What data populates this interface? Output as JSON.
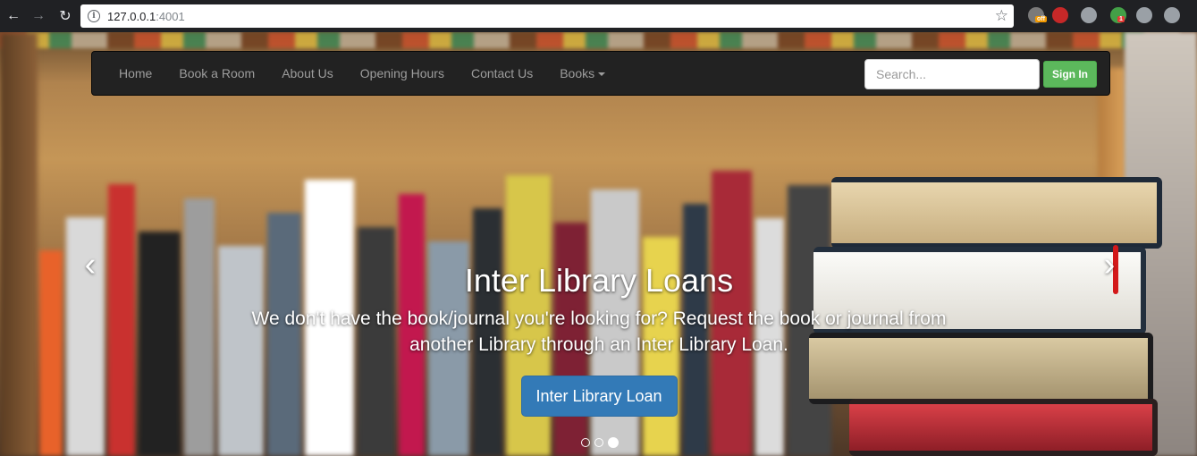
{
  "browser": {
    "url_host": "127.0.0.1",
    "url_port": ":4001",
    "extensions": [
      {
        "icon": "extension-off-icon",
        "badge": "off",
        "color": "#7a7a7a",
        "badge_color": "#f29900"
      },
      {
        "icon": "ublock-icon",
        "badge": "",
        "color": "#c62828",
        "badge_color": ""
      },
      {
        "icon": "comment-icon",
        "badge": "",
        "color": "#9aa0a6",
        "badge_color": ""
      },
      {
        "icon": "pushbullet-icon",
        "badge": "1",
        "color": "#43a047",
        "badge_color": "#e53935"
      },
      {
        "icon": "search-extension-icon",
        "badge": "",
        "color": "#9aa0a6",
        "badge_color": ""
      },
      {
        "icon": "drive-icon",
        "badge": "",
        "color": "#9aa0a6",
        "badge_color": ""
      }
    ]
  },
  "navbar": {
    "links": [
      "Home",
      "Book a Room",
      "About Us",
      "Opening Hours",
      "Contact Us",
      "Books"
    ],
    "search_placeholder": "Search...",
    "signin_label": "Sign In"
  },
  "carousel": {
    "title": "Inter Library Loans",
    "text": "We don't have the book/journal you're looking for? Request the book or journal from another Library through an Inter Library Loan.",
    "button_label": "Inter Library Loan",
    "slide_count": 3,
    "active_slide": 3,
    "prev_icon": "chevron-left-icon",
    "next_icon": "chevron-right-icon"
  },
  "colors": {
    "navbar_bg": "#222222",
    "signin_green": "#5cb85c",
    "primary_blue": "#337ab7"
  }
}
